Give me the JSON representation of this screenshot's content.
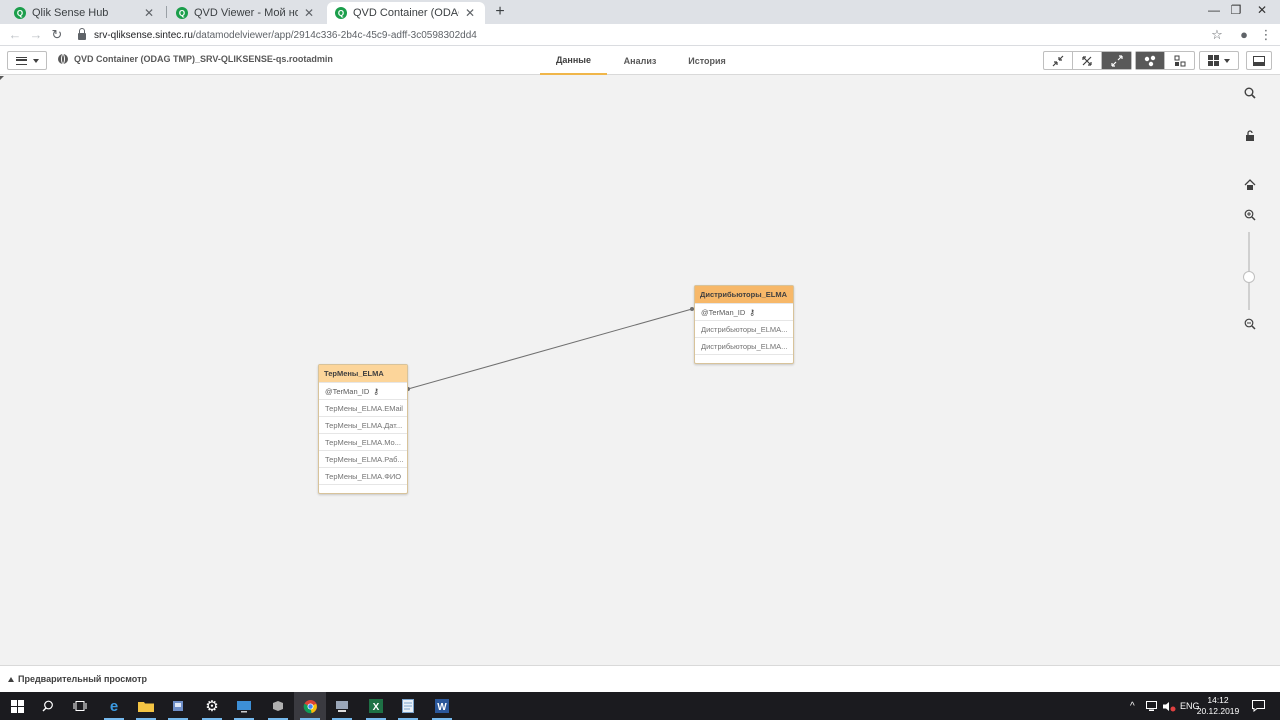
{
  "browser": {
    "tabs": [
      {
        "label": "Qlik Sense Hub",
        "favicon": "Q"
      },
      {
        "label": "QVD Viewer - Мой новый лист (",
        "favicon": "Q"
      },
      {
        "label": "QVD Container (ODAG TMP)_SRV",
        "favicon": "Q"
      }
    ],
    "new_tab": "+",
    "close_glyph": "✕",
    "url_host": "srv-qliksense.sintec.ru",
    "url_path": "/datamodelviewer/app/2914c336-2b4c-45c9-adff-3c0598302dd4",
    "window_controls": [
      "—",
      "❐",
      "✕"
    ]
  },
  "qlik": {
    "app_title": "QVD Container (ODAG TMP)_SRV-QLIKSENSE-qs.rootadmin",
    "nav_tabs": [
      {
        "label": "Данные",
        "active": true
      },
      {
        "label": "Анализ",
        "active": false
      },
      {
        "label": "История",
        "active": false
      }
    ],
    "accent_color": "#f0b64a"
  },
  "tables": [
    {
      "name": "ТерМены_ELMA",
      "fields": [
        {
          "label": "@TerMan_ID",
          "key": true
        },
        {
          "label": "ТерМены_ELMA.EMail"
        },
        {
          "label": "ТерМены_ELMA.Дат..."
        },
        {
          "label": "ТерМены_ELMA.Мо..."
        },
        {
          "label": "ТерМены_ELMA.Раб..."
        },
        {
          "label": "ТерМены_ELMA.ФИО"
        }
      ]
    },
    {
      "name": "Дистрибьюторы_ELMA",
      "fields": [
        {
          "label": "@TerMan_ID",
          "key": true
        },
        {
          "label": "Дистрибьюторы_ELMA..."
        },
        {
          "label": "Дистрибьюторы_ELMA..."
        }
      ]
    }
  ],
  "preview_label": "Предварительный просмотр",
  "taskbar": {
    "lang": "ENG",
    "time": "14:12",
    "date": "20.12.2019"
  }
}
